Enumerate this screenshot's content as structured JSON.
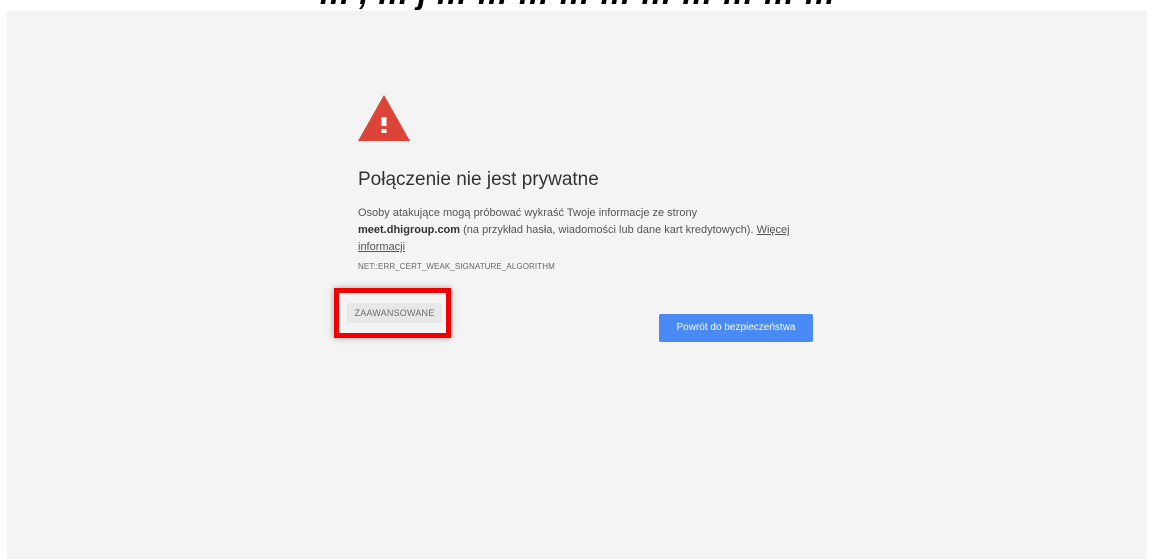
{
  "top_caption": "… , … j … … … … … … … … … …",
  "interstitial": {
    "title": "Połączenie nie jest prywatne",
    "description_line1": "Osoby atakujące mogą próbować wykraść Twoje informacje ze strony",
    "site": "meet.dhigroup.com",
    "description_line2": " (na przykład hasła, wiadomości lub dane kart kredytowych). ",
    "learn_more": "Więcej informacji",
    "error_code": "NET::ERR_CERT_WEAK_SIGNATURE_ALGORITHM",
    "advanced_label": "ZAAWANSOWANE",
    "back_label": "Powrót do bezpieczeństwa",
    "warning_icon": "warning-triangle-icon"
  },
  "colors": {
    "page_background": "#f4f4f4",
    "warning_red": "#db4437",
    "primary_blue": "#4a8af4",
    "highlight_red": "#f00000"
  }
}
